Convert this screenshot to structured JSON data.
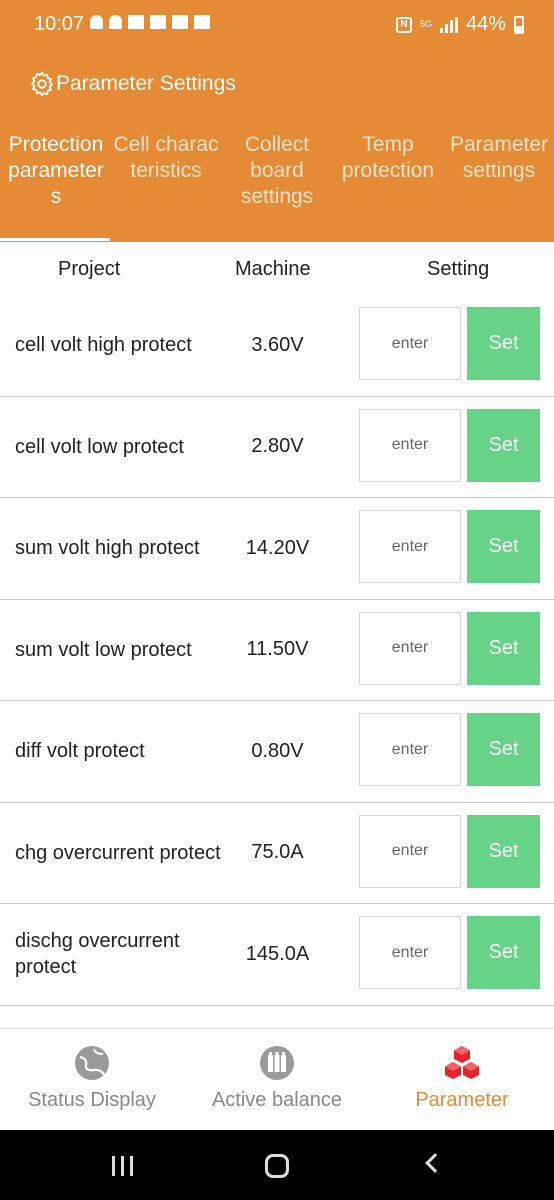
{
  "status_bar": {
    "time": "10:07",
    "battery": "44%",
    "network": "5G"
  },
  "header": {
    "title": "Parameter Settings",
    "icon": "gear-icon",
    "tabs": [
      {
        "label": "Protection parameter s",
        "active": true
      },
      {
        "label": "Cell charac teristics",
        "active": false
      },
      {
        "label": "Collect board settings",
        "active": false
      },
      {
        "label": "Temp protection",
        "active": false
      },
      {
        "label": "Parameter settings",
        "active": false
      }
    ]
  },
  "columns": {
    "project": "Project",
    "machine": "Machine",
    "setting": "Setting"
  },
  "rows": [
    {
      "name": "cell volt high protect",
      "value": "3.60V",
      "placeholder": "enter",
      "button": "Set"
    },
    {
      "name": "cell volt low protect",
      "value": "2.80V",
      "placeholder": "enter",
      "button": "Set"
    },
    {
      "name": "sum volt high protect",
      "value": "14.20V",
      "placeholder": "enter",
      "button": "Set"
    },
    {
      "name": "sum volt low protect",
      "value": "11.50V",
      "placeholder": "enter",
      "button": "Set"
    },
    {
      "name": "diff volt protect",
      "value": "0.80V",
      "placeholder": "enter",
      "button": "Set"
    },
    {
      "name": "chg overcurrent protect",
      "value": "75.0A",
      "placeholder": "enter",
      "button": "Set"
    },
    {
      "name": "dischg overcurrent protect",
      "value": "145.0A",
      "placeholder": "enter",
      "button": "Set"
    }
  ],
  "bottom_nav": [
    {
      "label": "Status Display",
      "icon": "globe-icon",
      "active": false
    },
    {
      "label": "Active balance",
      "icon": "balance-icon",
      "active": false
    },
    {
      "label": "Parameter",
      "icon": "cubes-icon",
      "active": true
    }
  ],
  "colors": {
    "accent": "#e58a35",
    "set_button": "#66d386",
    "inactive_text": "#888888"
  }
}
